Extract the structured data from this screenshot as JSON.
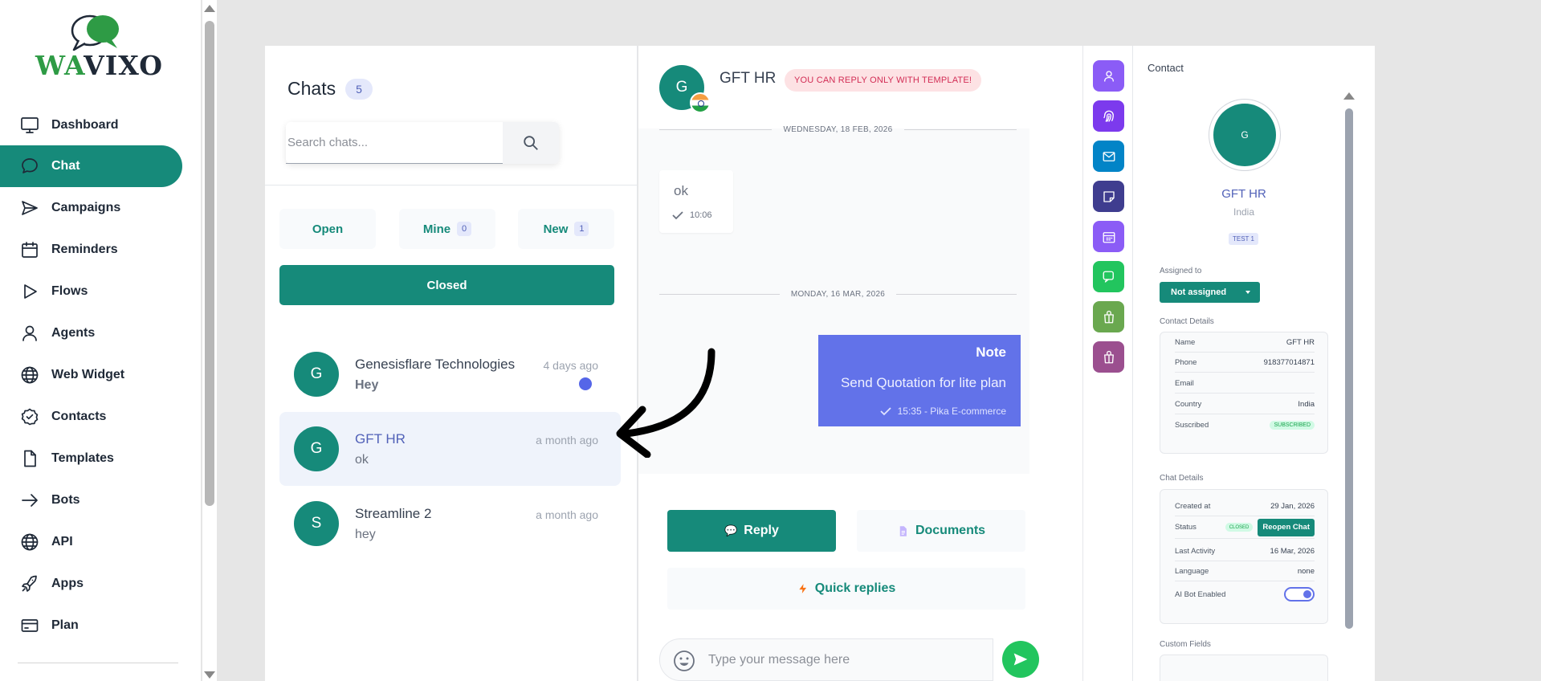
{
  "brand": {
    "logo_prefix": "WA",
    "logo_suffix": "VIXO",
    "accent": "#168a7a"
  },
  "sidebar": {
    "items": [
      {
        "label": "Dashboard",
        "icon": "monitor-icon"
      },
      {
        "label": "Chat",
        "icon": "chat-bubble-icon",
        "active": true
      },
      {
        "label": "Campaigns",
        "icon": "send-icon"
      },
      {
        "label": "Reminders",
        "icon": "calendar-icon"
      },
      {
        "label": "Flows",
        "icon": "play-icon"
      },
      {
        "label": "Agents",
        "icon": "user-icon"
      },
      {
        "label": "Web Widget",
        "icon": "globe-icon"
      },
      {
        "label": "Contacts",
        "icon": "check-badge-icon"
      },
      {
        "label": "Templates",
        "icon": "file-icon"
      },
      {
        "label": "Bots",
        "icon": "arrow-right-icon"
      },
      {
        "label": "API",
        "icon": "globe-icon"
      },
      {
        "label": "Apps",
        "icon": "rocket-icon"
      },
      {
        "label": "Plan",
        "icon": "credit-card-icon"
      }
    ]
  },
  "chats": {
    "title": "Chats",
    "count": "5",
    "search_placeholder": "Search chats...",
    "tabs": [
      {
        "label": "Open",
        "count": ""
      },
      {
        "label": "Mine",
        "count": "0"
      },
      {
        "label": "New",
        "count": "1"
      }
    ],
    "closed_label": "Closed",
    "list": [
      {
        "initial": "G",
        "name": "Genesisflare Technologies",
        "time": "4 days ago",
        "message": "Hey",
        "unread": true
      },
      {
        "initial": "G",
        "name": "GFT HR",
        "time": "a month ago",
        "message": "ok",
        "selected": true
      },
      {
        "initial": "S",
        "name": "Streamline 2",
        "time": "a month ago",
        "message": "hey"
      }
    ]
  },
  "conversation": {
    "initial": "G",
    "name": "GFT HR",
    "badge": "YOU CAN REPLY ONLY WITH TEMPLATE!",
    "date_top": "WEDNESDAY, 18 FEB, 2026",
    "incoming": {
      "text": "ok",
      "time": "10:06"
    },
    "date_mid": "MONDAY, 16 MAR, 2026",
    "note": {
      "title": "Note",
      "body": "Send Quotation for lite plan",
      "meta": "15:35 - Pika E-commerce"
    },
    "actions": {
      "reply": "Reply",
      "documents": "Documents",
      "quick_replies": "Quick replies"
    },
    "composer_placeholder": "Type your message here"
  },
  "rail": {
    "buttons": [
      {
        "icon": "user-icon",
        "color": "#8b5cf6"
      },
      {
        "icon": "fingerprint-icon",
        "color": "#7c3aed"
      },
      {
        "icon": "mail-icon",
        "color": "#0284c7"
      },
      {
        "icon": "sticky-note-icon",
        "color": "#3f3d8f"
      },
      {
        "icon": "calendar-icon",
        "color": "#8b5cf6"
      },
      {
        "icon": "whatsapp-icon",
        "color": "#22c55e"
      },
      {
        "icon": "shopify-icon",
        "color": "#6aa84f"
      },
      {
        "icon": "woocommerce-icon",
        "color": "#9b4f8f"
      }
    ]
  },
  "contact": {
    "title": "Contact",
    "initial": "G",
    "name": "GFT HR",
    "country": "India",
    "tag": "TEST 1",
    "assigned_label": "Assigned to",
    "assigned_value": "Not assigned",
    "details_label": "Contact Details",
    "details": [
      {
        "key": "Name",
        "value": "GFT HR"
      },
      {
        "key": "Phone",
        "value": "918377014871"
      },
      {
        "key": "Email",
        "value": ""
      },
      {
        "key": "Country",
        "value": "India"
      },
      {
        "key": "Suscribed",
        "value": "SUBSCRIBED"
      }
    ],
    "chat_details_label": "Chat Details",
    "chat_details": {
      "created_key": "Created at",
      "created_value": "29 Jan, 2026",
      "status_key": "Status",
      "status_pill": "CLOSED",
      "reopen_label": "Reopen Chat",
      "activity_key": "Last Activity",
      "activity_value": "16 Mar, 2026",
      "language_key": "Language",
      "language_value": "none",
      "bot_key": "AI Bot Enabled",
      "bot_enabled": true
    },
    "custom_fields_label": "Custom Fields"
  }
}
